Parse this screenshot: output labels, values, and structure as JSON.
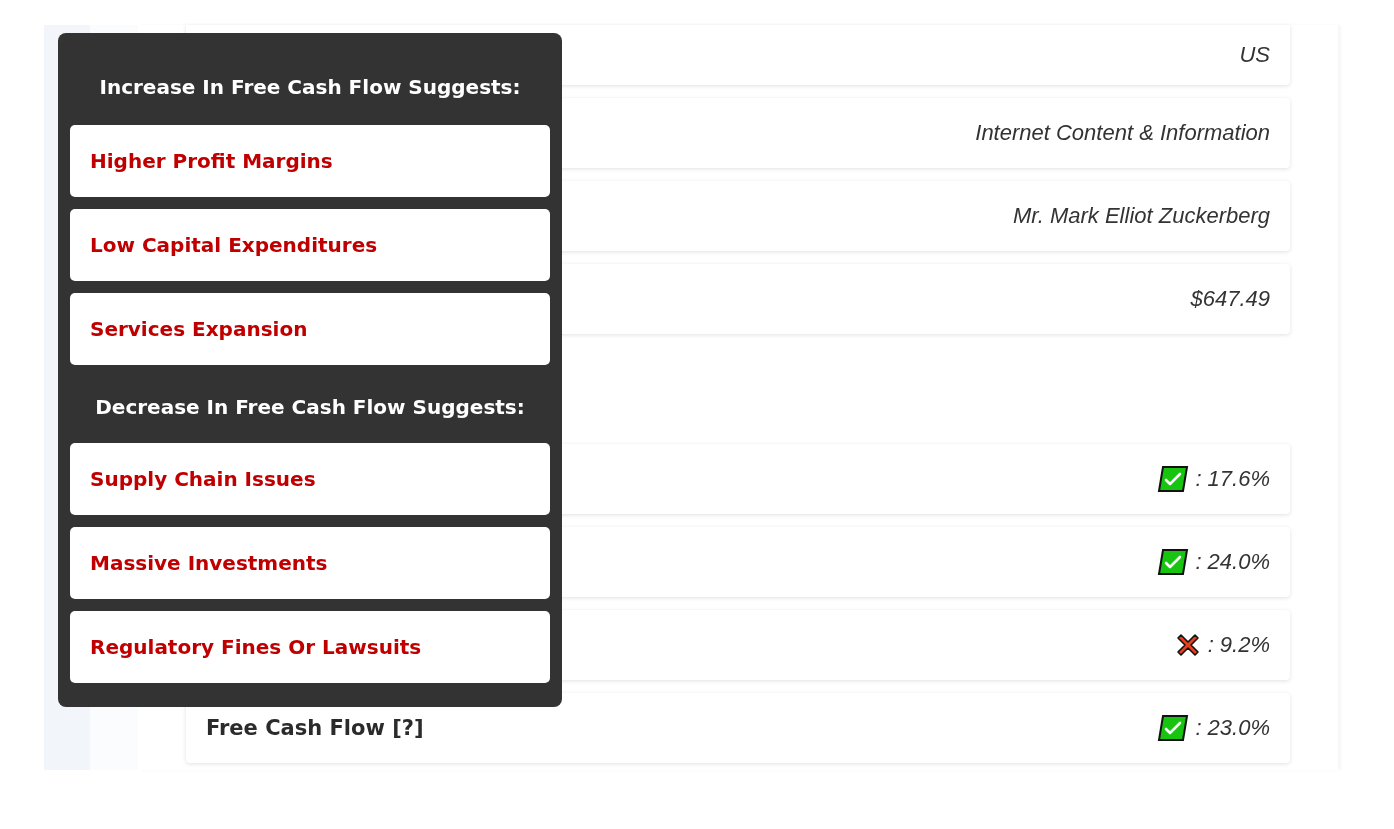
{
  "info_rows": [
    {
      "value": "US"
    },
    {
      "value": "Internet Content & Information"
    },
    {
      "value": "Mr. Mark Elliot Zuckerberg"
    },
    {
      "value": "$647.49"
    }
  ],
  "metric_rows": [
    {
      "passed": true,
      "value": ": 17.6%"
    },
    {
      "passed": true,
      "value": ": 24.0%"
    },
    {
      "passed": false,
      "value": ": 9.2%"
    },
    {
      "label": "Free Cash Flow [?]",
      "passed": true,
      "value": ": 23.0%"
    }
  ],
  "tooltip": {
    "sections": [
      {
        "heading": "Increase In Free Cash Flow Suggests:",
        "items": [
          "Higher Profit Margins",
          "Low Capital Expenditures",
          "Services Expansion"
        ]
      },
      {
        "heading": "Decrease In Free Cash Flow Suggests:",
        "items": [
          "Supply Chain Issues",
          "Massive Investments",
          "Regulatory Fines Or Lawsuits"
        ]
      }
    ]
  }
}
